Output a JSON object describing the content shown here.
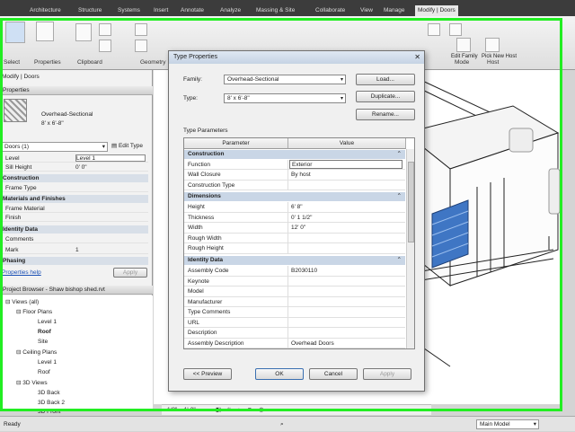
{
  "ribbon": {
    "tabs": [
      "Architecture",
      "Structure",
      "Systems",
      "Insert",
      "Annotate",
      "Analyze",
      "Massing & Site",
      "Collaborate",
      "View",
      "Manage",
      "Modify | Doors"
    ],
    "groups": [
      "Select",
      "Properties",
      "Clipboard",
      "Geometry",
      "Mode",
      "Host"
    ],
    "group_buttons": [
      "Edit Family",
      "Pick New Host"
    ]
  },
  "left": {
    "context_label": "Modify | Doors",
    "properties_header": "Properties",
    "family_name": "Overhead-Sectional",
    "family_type": "8' x 6'-8\"",
    "instance_selector": "Doors (1)",
    "edit_type_label": "Edit Type",
    "rows_top": [
      {
        "k": "Level",
        "v": "Level 1"
      },
      {
        "k": "Sill Height",
        "v": "0' 0\""
      }
    ],
    "cat_construction": "Construction",
    "row_frame_type": "Frame Type",
    "cat_materials": "Materials and Finishes",
    "row_frame_material": "Frame Material",
    "row_finish": "Finish",
    "cat_identity": "Identity Data",
    "row_comments": "Comments",
    "row_mark_k": "Mark",
    "row_mark_v": "1",
    "cat_phasing": "Phasing",
    "properties_help": "Properties help",
    "apply_label": "Apply",
    "browser_header": "Project Browser - Shaw bishop shed.rvt",
    "tree": [
      "Views (all)",
      "Floor Plans",
      "Level 1",
      "Roof",
      "Site",
      "Ceiling Plans",
      "Level 1",
      "Roof",
      "3D Views",
      "3D Back",
      "3D Back 2",
      "3D Front"
    ]
  },
  "dialog": {
    "title": "Type Properties",
    "family_label": "Family:",
    "family_value": "Overhead-Sectional",
    "type_label": "Type:",
    "type_value": "8' x 6'-8\"",
    "load_button": "Load...",
    "duplicate_button": "Duplicate...",
    "rename_button": "Rename...",
    "type_parameters_label": "Type Parameters",
    "col_parameter": "Parameter",
    "col_value": "Value",
    "cat_construction": "Construction",
    "rows_construction": [
      {
        "k": "Function",
        "v": "Exterior"
      },
      {
        "k": "Wall Closure",
        "v": "By host"
      },
      {
        "k": "Construction Type",
        "v": ""
      }
    ],
    "cat_dimensions": "Dimensions",
    "rows_dimensions": [
      {
        "k": "Height",
        "v": "6' 8\""
      },
      {
        "k": "Thickness",
        "v": "0' 1 1/2\""
      },
      {
        "k": "Width",
        "v": "12' 0\""
      },
      {
        "k": "Rough Width",
        "v": ""
      },
      {
        "k": "Rough Height",
        "v": ""
      }
    ],
    "cat_identity": "Identity Data",
    "rows_identity": [
      {
        "k": "Assembly Code",
        "v": "B2030110"
      },
      {
        "k": "Keynote",
        "v": ""
      },
      {
        "k": "Model",
        "v": ""
      },
      {
        "k": "Manufacturer",
        "v": ""
      },
      {
        "k": "Type Comments",
        "v": ""
      },
      {
        "k": "URL",
        "v": ""
      },
      {
        "k": "Description",
        "v": ""
      },
      {
        "k": "Assembly Description",
        "v": "Overhead Doors"
      }
    ],
    "preview_button": "<< Preview",
    "ok_button": "OK",
    "cancel_button": "Cancel",
    "apply_button": "Apply"
  },
  "view_controls": {
    "scale": "1/8\" = 1'-0\""
  },
  "status": {
    "text": "Ready",
    "model_selector": "Main Model"
  },
  "colors": {
    "highlight_frame": "#22ee22",
    "category_row": "#c9d6e6"
  }
}
